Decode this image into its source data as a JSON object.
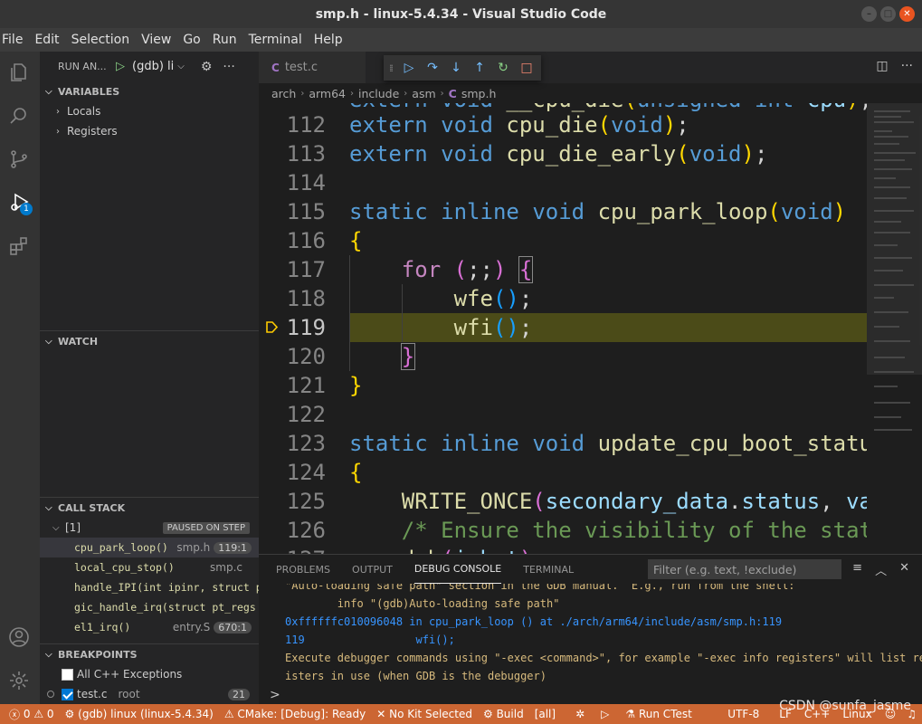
{
  "window": {
    "title": "smp.h - linux-5.4.34 - Visual Studio Code"
  },
  "menu": [
    "File",
    "Edit",
    "Selection",
    "View",
    "Go",
    "Run",
    "Terminal",
    "Help"
  ],
  "run_panel": {
    "header": "RUN AN...",
    "config": "(gdb) li",
    "variables": {
      "title": "VARIABLES",
      "items": [
        "Locals",
        "Registers"
      ]
    },
    "watch": {
      "title": "WATCH"
    },
    "call_stack": {
      "title": "CALL STACK",
      "thread": "[1]",
      "thread_state": "PAUSED ON STEP",
      "frames": [
        {
          "fn": "cpu_park_loop()",
          "file": "smp.h",
          "pos": "119:1"
        },
        {
          "fn": "local_cpu_stop()",
          "file": "smp.c",
          "pos": ""
        },
        {
          "fn": "handle_IPI(int ipinr, struct pt_",
          "file": "",
          "pos": ""
        },
        {
          "fn": "gic_handle_irq(struct pt_regs *",
          "file": "",
          "pos": ""
        },
        {
          "fn": "el1_irq()",
          "file": "entry.S",
          "pos": "670:1"
        }
      ]
    },
    "breakpoints": {
      "title": "BREAKPOINTS",
      "items": [
        {
          "label": "All C++ Exceptions",
          "extra": "",
          "count": ""
        },
        {
          "label": "test.c",
          "extra": "root",
          "count": "21"
        }
      ]
    }
  },
  "activity_badge": "1",
  "editor": {
    "tab": "test.c",
    "breadcrumb": [
      "arch",
      "arm64",
      "include",
      "asm",
      "smp.h"
    ],
    "lines": [
      {
        "n": "112",
        "text": "extern void cpu_die(void);"
      },
      {
        "n": "113",
        "text": "extern void cpu_die_early(void);"
      },
      {
        "n": "114",
        "text": ""
      },
      {
        "n": "115",
        "text": "static inline void cpu_park_loop(void)"
      },
      {
        "n": "116",
        "text": "{"
      },
      {
        "n": "117",
        "text": "for (;;) {"
      },
      {
        "n": "118",
        "text": "wfe();"
      },
      {
        "n": "119",
        "text": "wfi();"
      },
      {
        "n": "120",
        "text": "}"
      },
      {
        "n": "121",
        "text": "}"
      },
      {
        "n": "122",
        "text": ""
      },
      {
        "n": "123",
        "text": "static inline void update_cpu_boot_statu"
      },
      {
        "n": "124",
        "text": "{"
      },
      {
        "n": "125",
        "text": "WRITE_ONCE(secondary_data.status, va"
      },
      {
        "n": "126",
        "text": "/* Ensure the visibility of the stat"
      }
    ]
  },
  "panel": {
    "tabs": [
      "PROBLEMS",
      "OUTPUT",
      "DEBUG CONSOLE",
      "TERMINAL"
    ],
    "filter_placeholder": "Filter (e.g. text, !exclude)",
    "console_lines": [
      "\"Auto-loading safe path\" section in the GDB manual.  E.g., run from the shell:",
      "        info \"(gdb)Auto-loading safe path\"",
      "0xffffffc010096048 in cpu_park_loop () at ./arch/arm64/include/asm/smp.h:119",
      "119                 wfi();",
      "Execute debugger commands using \"-exec <command>\", for example \"-exec info registers\" will list reg",
      "isters in use (when GDB is the debugger)"
    ],
    "prompt": ">"
  },
  "statusbar": {
    "errors": "0",
    "warnings": "0",
    "debug": "(gdb) linux (linux-5.4.34)",
    "cmake": "CMake: [Debug]: Ready",
    "kit": "No Kit Selected",
    "build": "Build",
    "target": "[all]",
    "ctest": "Run CTest",
    "encoding": "UTF-8",
    "eol": "LF",
    "lang": "C++",
    "os": "Linux"
  },
  "watermark": "CSDN @sunfa_jasme",
  "colors": {
    "statusbar": "#cc6633",
    "accent": "#007acc"
  }
}
